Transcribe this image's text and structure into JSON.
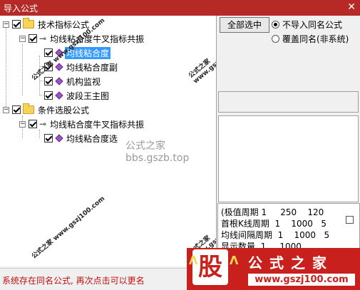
{
  "window": {
    "title": "导入公式",
    "close_glyph": "✕"
  },
  "tree": {
    "nodes": [
      {
        "label": "技术指标公式"
      },
      {
        "label": "均线粘合度牛叉指标共振"
      },
      {
        "label": "均线粘合度"
      },
      {
        "label": "均线粘合度副"
      },
      {
        "label": "机构监视"
      },
      {
        "label": "波段王主图"
      },
      {
        "label": "条件选股公式"
      },
      {
        "label": "均线粘合度牛叉指标共振"
      },
      {
        "label": "均线粘合度选"
      }
    ],
    "expand_glyph": "−"
  },
  "watermarks": {
    "center": "公式之家 bbs.gszb.top",
    "stamp": "公式之家 www.gszj100.com"
  },
  "right_panel": {
    "select_all_label": "全部选中",
    "radio_options": [
      {
        "label": "不导入同名公式",
        "selected": true
      },
      {
        "label": "覆盖同名(非系统)",
        "selected": false
      }
    ]
  },
  "params": {
    "rows": [
      "(极值周期 1     250    120",
      "首根K线周期  1    1000   5",
      "均线间隔周期  1    1000   5",
      "显示数量  1     1000"
    ]
  },
  "status": {
    "text": "系统存在同名公式, 再次点击可以更名"
  },
  "banner": {
    "glyph": "股",
    "name": "公式之家",
    "url": "www.gszj100.com",
    "accent": "#c8201c"
  }
}
